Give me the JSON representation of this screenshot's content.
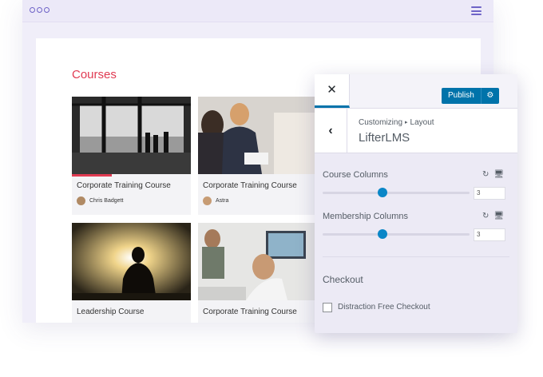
{
  "page": {
    "title": "Courses",
    "cards": [
      {
        "title": "Corporate Training Course",
        "author": "Chris Badgett"
      },
      {
        "title": "Corporate Training Course",
        "author": "Astra"
      },
      {
        "title": "Leadership Course",
        "author": ""
      },
      {
        "title": "Corporate Training Course",
        "author": ""
      }
    ]
  },
  "customizer": {
    "close_label": "✕",
    "publish_label": "Publish",
    "back_label": "‹",
    "breadcrumb": {
      "root": "Customizing",
      "separator": "▸",
      "current": "Layout"
    },
    "section_title": "LifterLMS",
    "controls": [
      {
        "label": "Course Columns",
        "value": "3",
        "fraction": 0.4
      },
      {
        "label": "Membership Columns",
        "value": "3",
        "fraction": 0.4
      }
    ],
    "checkout": {
      "heading": "Checkout",
      "option_label": "Distraction Free Checkout",
      "checked": false
    }
  },
  "colors": {
    "accent": "#e03a52",
    "primary": "#0073aa",
    "brand": "#6e63c7"
  }
}
